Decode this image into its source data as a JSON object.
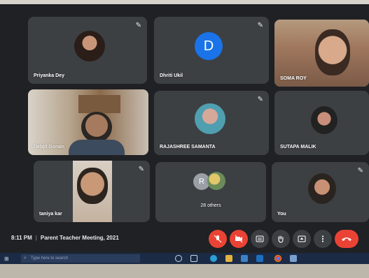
{
  "participants": [
    {
      "name": "Priyanka Dey",
      "muted": true
    },
    {
      "name": "Dhriti Ukil",
      "initial": "D",
      "muted": true
    },
    {
      "name": "SOMA ROY",
      "muted": false,
      "speaking": true
    },
    {
      "name": "Debjit Gorain",
      "muted": false
    },
    {
      "name": "RAJASHREE SAMANTA",
      "muted": true
    },
    {
      "name": "SUTAPA MALIK",
      "muted": false
    },
    {
      "name": "taniya kar",
      "muted": true
    },
    {
      "name": "28 others",
      "initial": "R",
      "muted": false
    },
    {
      "name": "You",
      "muted": true
    }
  ],
  "meeting": {
    "time": "8:11 PM",
    "separator": "|",
    "title": "Parent Teacher Meeting, 2021"
  },
  "controls": {
    "mic": "mic-off-icon",
    "camera": "camera-off-icon",
    "captions": "captions-icon",
    "raise_hand": "hand-icon",
    "present": "present-icon",
    "more": "more-vert-icon",
    "end_call": "end-call-icon"
  },
  "taskbar": {
    "search_placeholder": "Type here to search"
  },
  "colors": {
    "tile_bg": "#3c4043",
    "screen_bg": "#1f2124",
    "speaking_outline": "#8ab4f8",
    "avatar_blue": "#1a73e8",
    "danger_red": "#ea4335"
  }
}
